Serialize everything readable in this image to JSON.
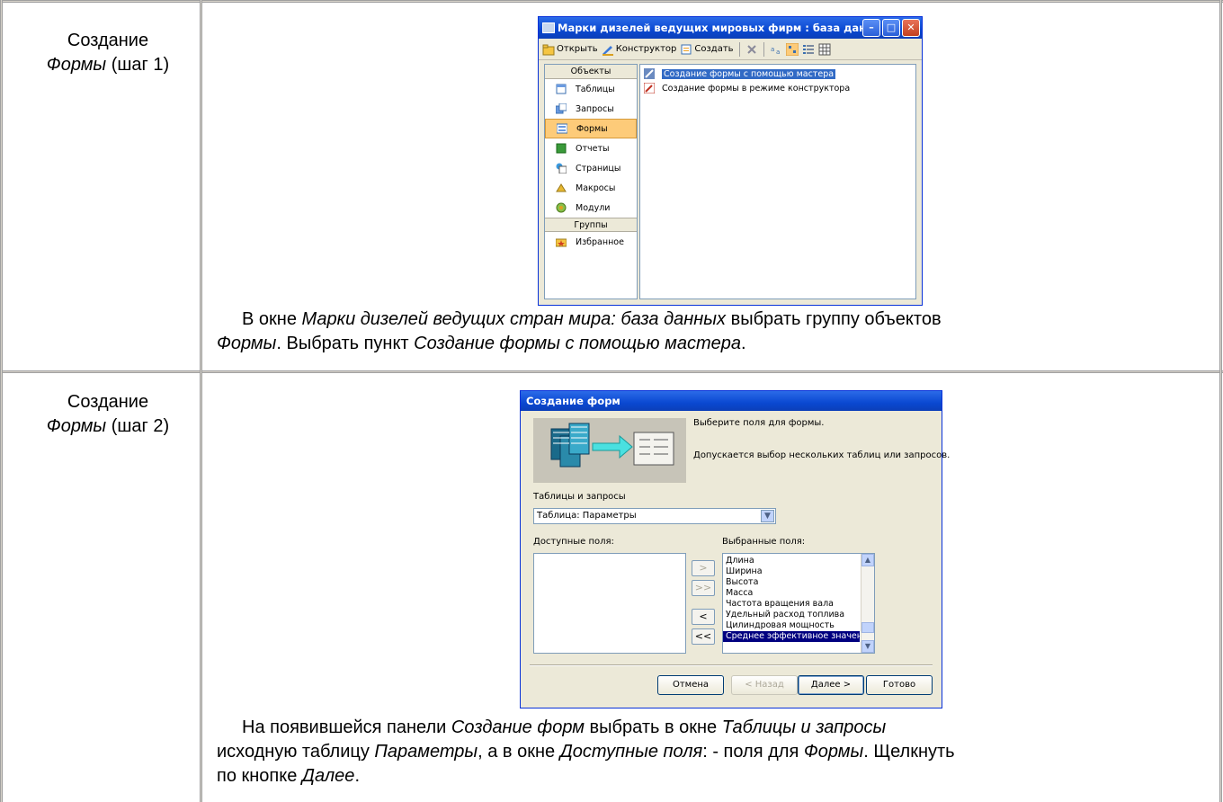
{
  "row1": {
    "label_line1": "Создание",
    "label_italic": "Формы",
    "label_rest": " (шаг 1)",
    "window": {
      "title": "Марки дизелей ведущих мировых фирм : база данных (...",
      "toolbar": {
        "open": "Открыть",
        "designer": "Конструктор",
        "create": "Создать"
      },
      "objects_header": "Объекты",
      "objects": [
        "Таблицы",
        "Запросы",
        "Формы",
        "Отчеты",
        "Страницы",
        "Макросы",
        "Модули"
      ],
      "groups_header": "Группы",
      "groups": [
        "Избранное"
      ],
      "items": [
        "Создание формы с помощью мастера",
        "Создание формы в режиме конструктора"
      ]
    },
    "caption": {
      "t1": "В окне ",
      "i1": "Марки дизелей ведущих стран мира: база данных",
      "t2": " выбрать группу объектов",
      "i2": "Формы",
      "t3": ". Выбрать пункт ",
      "i3": "Создание формы с помощью мастера",
      "t4": "."
    }
  },
  "row2": {
    "label_line1": "Создание",
    "label_italic": "Формы",
    "label_rest": " (шаг 2)",
    "window": {
      "title": "Создание форм",
      "hint1": "Выберите поля для формы.",
      "hint2": "Допускается выбор нескольких таблиц или запросов.",
      "tables_label": "Таблицы и запросы",
      "combo_value": "Таблица: Параметры",
      "available_label": "Доступные поля:",
      "selected_label": "Выбранные поля:",
      "selected_fields": [
        "Длина",
        "Ширина",
        "Высота",
        "Масса",
        "Частота вращения вала",
        "Удельный расход топлива",
        "Цилиндровая мощность",
        "Среднее эффективное значен"
      ],
      "btn_add": ">",
      "btn_add_all": ">>",
      "btn_remove": "<",
      "btn_remove_all": "<<",
      "btn_cancel": "Отмена",
      "btn_back": "< Назад",
      "btn_next": "Далее >",
      "btn_finish": "Готово"
    },
    "caption": {
      "t1": "На появившейся панели ",
      "i1": "Создание форм",
      "t2": " выбрать в окне ",
      "i2": "Таблицы и запросы",
      "t3": "исходную таблицу ",
      "i3": "Параметры",
      "t4": ", а в окне ",
      "i4": "Доступные поля",
      "t5": ": - поля для ",
      "i5": "Формы",
      "t6": ". Щелкнуть",
      "t7": "по кнопке ",
      "i6": "Далее",
      "t8": "."
    }
  }
}
